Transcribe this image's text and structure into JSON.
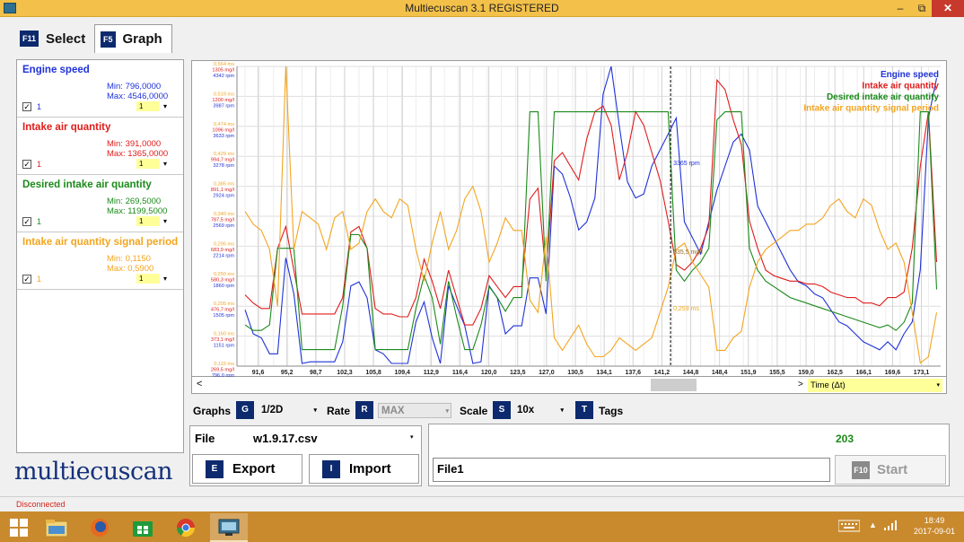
{
  "window": {
    "title": "Multiecuscan 3.1 REGISTERED",
    "minimize": "–",
    "maximize": "⧉",
    "close": "✕"
  },
  "tabs": [
    {
      "key": "F11",
      "label": "Select"
    },
    {
      "key": "F5",
      "label": "Graph"
    }
  ],
  "variables": [
    {
      "name": "Engine speed",
      "min": "Min: 796,0000",
      "max": "Max: 4546,0000",
      "color": "#1f32d8",
      "count": "1",
      "scale": "1"
    },
    {
      "name": "Intake air quantity",
      "min": "Min: 391,0000",
      "max": "Max: 1365,0000",
      "color": "#e01c1c",
      "count": "1",
      "scale": "1"
    },
    {
      "name": "Desired intake air quantity",
      "min": "Min: 269,5000",
      "max": "Max: 1199,5000",
      "color": "#1b8a1b",
      "count": "1",
      "scale": "1"
    },
    {
      "name": "Intake air quantity signal period",
      "min": "Min: 0,1150",
      "max": "Max: 0,5900",
      "color": "#f3a51f",
      "count": "1",
      "scale": "1"
    }
  ],
  "logo": "multiecuscan",
  "chart_data": {
    "type": "line",
    "x": [
      90,
      91,
      92,
      93,
      94,
      95,
      96,
      97,
      98,
      99,
      100,
      101,
      102,
      103,
      104,
      105,
      106,
      107,
      108,
      109,
      110,
      111,
      112,
      113,
      114,
      115,
      116,
      117,
      118,
      119,
      120,
      121,
      122,
      123,
      124,
      125,
      126,
      127,
      128,
      129,
      130,
      131,
      132,
      133,
      134,
      135,
      136,
      137,
      138,
      139,
      140,
      141,
      142,
      143,
      144,
      145,
      146,
      147,
      148,
      149,
      150,
      151,
      152,
      153,
      154,
      155,
      156,
      157,
      158,
      159,
      160,
      161,
      162,
      163,
      164,
      165,
      166,
      167,
      168,
      169,
      170,
      171,
      172,
      173,
      174,
      175
    ],
    "x_ticks": [
      "91,6",
      "95,2",
      "98,7",
      "102,3",
      "105,8",
      "109,4",
      "112,9",
      "116,4",
      "120,0",
      "123,5",
      "127,0",
      "130,5",
      "134,1",
      "137,6",
      "141,2",
      "144,8",
      "148,4",
      "151,9",
      "155,5",
      "159,0",
      "162,5",
      "166,1",
      "169,6",
      "173,1"
    ],
    "y_axis": {
      "signal_period": [
        "0,564 ms",
        "0,519 ms",
        "0,474 ms",
        "0,429 ms",
        "0,385 ms",
        "0,340 ms",
        "0,295 ms",
        "0,250 ms",
        "0,205 ms",
        "0,160 ms",
        "0,115 ms"
      ],
      "air_quantity": [
        "1305 mg/l",
        "1200 mg/l",
        "1096 mg/l",
        "994,7 mg/l",
        "891,1 mg/l",
        "787,5 mg/l",
        "683,9 mg/l",
        "580,3 mg/l",
        "476,7 mg/l",
        "373,1 mg/l",
        "269,5 mg/l"
      ],
      "rpm": [
        "4342 rpm",
        "3987 rpm",
        "3633 rpm",
        "3278 rpm",
        "2924 rpm",
        "2569 rpm",
        "2214 rpm",
        "1860 rpm",
        "1505 rpm",
        "1151 rpm",
        "796,0 rpm"
      ]
    },
    "cursor": {
      "x": 142.3,
      "labels": [
        "3365 rpm",
        "635,5 mg/l",
        "0,259 ms"
      ]
    },
    "legend_position": "top-right",
    "grid": true,
    "series": [
      {
        "name": "Engine speed",
        "color": "#1f32d8",
        "values": [
          1500,
          1200,
          1150,
          950,
          950,
          2150,
          1700,
          830,
          850,
          850,
          850,
          850,
          1100,
          1800,
          1850,
          1650,
          1000,
          950,
          830,
          830,
          830,
          1350,
          1600,
          1150,
          830,
          1800,
          1550,
          1300,
          830,
          850,
          1800,
          1650,
          1200,
          1300,
          1300,
          1900,
          1900,
          1450,
          3300,
          3200,
          2900,
          2500,
          2600,
          2900,
          4200,
          4546,
          3800,
          3100,
          2900,
          2950,
          3300,
          3500,
          3700,
          3900,
          2600,
          2400,
          2200,
          2600,
          3000,
          3300,
          3600,
          3700,
          3500,
          2800,
          2600,
          2400,
          2200,
          2000,
          1850,
          1800,
          1700,
          1650,
          1500,
          1350,
          1300,
          1200,
          1100,
          1050,
          1000,
          1100,
          1000,
          1200,
          1350,
          2000,
          3900,
          4400
        ]
      },
      {
        "name": "Intake air quantity",
        "color": "#e01c1c",
        "values": [
          530,
          500,
          480,
          480,
          700,
          780,
          620,
          460,
          460,
          460,
          460,
          460,
          520,
          760,
          780,
          700,
          480,
          460,
          460,
          450,
          450,
          520,
          660,
          580,
          480,
          620,
          520,
          420,
          420,
          480,
          600,
          560,
          520,
          560,
          560,
          880,
          920,
          600,
          1020,
          1050,
          1000,
          950,
          1100,
          1200,
          1220,
          1150,
          950,
          1050,
          1200,
          1150,
          1050,
          950,
          800,
          640,
          620,
          650,
          700,
          780,
          1315,
          1280,
          1170,
          1080,
          800,
          700,
          620,
          600,
          590,
          580,
          580,
          570,
          570,
          560,
          540,
          530,
          520,
          520,
          500,
          500,
          490,
          520,
          520,
          540,
          700,
          1000,
          1200,
          650
        ]
      },
      {
        "name": "Desired intake air quantity",
        "color": "#1b8a1b",
        "values": [
          420,
          400,
          400,
          420,
          700,
          700,
          700,
          330,
          330,
          330,
          330,
          330,
          490,
          750,
          750,
          700,
          330,
          330,
          330,
          330,
          330,
          480,
          600,
          520,
          350,
          580,
          450,
          330,
          330,
          420,
          560,
          520,
          470,
          520,
          520,
          1199,
          1199,
          580,
          1199,
          1199,
          1199,
          1199,
          1199,
          1199,
          1199,
          1199,
          1199,
          1199,
          1199,
          1199,
          1199,
          1199,
          1199,
          620,
          580,
          620,
          650,
          700,
          1170,
          1199,
          1199,
          1199,
          700,
          620,
          580,
          560,
          540,
          520,
          510,
          500,
          490,
          480,
          470,
          460,
          450,
          440,
          430,
          420,
          410,
          420,
          400,
          430,
          500,
          1199,
          1199,
          550
        ]
      },
      {
        "name": "Intake air quantity signal period",
        "color": "#f3a51f",
        "values": [
          0.36,
          0.34,
          0.33,
          0.3,
          0.21,
          0.59,
          0.3,
          0.36,
          0.35,
          0.34,
          0.3,
          0.35,
          0.36,
          0.3,
          0.31,
          0.36,
          0.38,
          0.36,
          0.35,
          0.38,
          0.37,
          0.3,
          0.25,
          0.31,
          0.36,
          0.3,
          0.33,
          0.38,
          0.4,
          0.36,
          0.28,
          0.31,
          0.35,
          0.33,
          0.33,
          0.22,
          0.2,
          0.32,
          0.16,
          0.14,
          0.16,
          0.18,
          0.15,
          0.13,
          0.13,
          0.14,
          0.16,
          0.15,
          0.14,
          0.15,
          0.16,
          0.2,
          0.24,
          0.3,
          0.31,
          0.28,
          0.26,
          0.24,
          0.14,
          0.14,
          0.16,
          0.17,
          0.24,
          0.28,
          0.3,
          0.31,
          0.32,
          0.33,
          0.33,
          0.34,
          0.34,
          0.35,
          0.37,
          0.38,
          0.36,
          0.35,
          0.38,
          0.37,
          0.33,
          0.3,
          0.31,
          0.28,
          0.2,
          0.12,
          0.13,
          0.2
        ]
      }
    ]
  },
  "scrollbar": {
    "left_arrow": "<",
    "right_arrow": ">",
    "time_select": "Time (Δt)"
  },
  "controls": {
    "graphs_label": "Graphs",
    "graphs_key": "G",
    "graphs_value": "1/2D",
    "rate_label": "Rate",
    "rate_key": "R",
    "rate_value": "MAX",
    "scale_label": "Scale",
    "scale_key": "S",
    "scale_value": "10x",
    "tags_key": "T",
    "tags_label": "Tags"
  },
  "file": {
    "label": "File",
    "name": "w1.9.17.csv"
  },
  "buttons": {
    "export_key": "E",
    "export": "Export",
    "import_key": "I",
    "import": "Import",
    "start_key": "F10",
    "start": "Start"
  },
  "status": {
    "count": "203",
    "file_input": "File1",
    "connection": "Disconnected"
  },
  "taskbar": {
    "time": "18:49",
    "date": "2017-09-01"
  }
}
